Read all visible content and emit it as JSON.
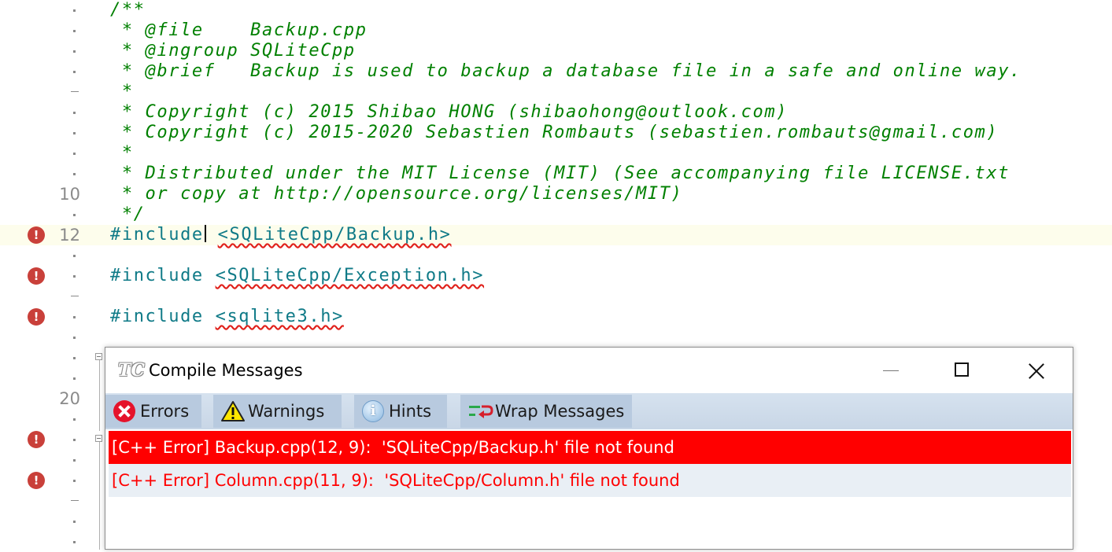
{
  "editor": {
    "lines": [
      {
        "gutter": "",
        "marker": "dot",
        "error": false,
        "segments": [
          {
            "cls": "comment",
            "text": "/**"
          }
        ]
      },
      {
        "gutter": "",
        "marker": "dot",
        "error": false,
        "segments": [
          {
            "cls": "comment",
            "text": " * @file    Backup.cpp"
          }
        ]
      },
      {
        "gutter": "",
        "marker": "dot",
        "error": false,
        "segments": [
          {
            "cls": "comment",
            "text": " * @ingroup SQLiteCpp"
          }
        ]
      },
      {
        "gutter": "",
        "marker": "dot",
        "error": false,
        "segments": [
          {
            "cls": "comment",
            "text": " * @brief   Backup is used to backup a database file in a safe and online way."
          }
        ]
      },
      {
        "gutter": "",
        "marker": "dash",
        "error": false,
        "segments": [
          {
            "cls": "comment",
            "text": " *"
          }
        ]
      },
      {
        "gutter": "",
        "marker": "dot",
        "error": false,
        "segments": [
          {
            "cls": "comment",
            "text": " * Copyright (c) 2015 Shibao HONG (shibaohong@outlook.com)"
          }
        ]
      },
      {
        "gutter": "",
        "marker": "dot",
        "error": false,
        "segments": [
          {
            "cls": "comment",
            "text": " * Copyright (c) 2015-2020 Sebastien Rombauts (sebastien.rombauts@gmail.com)"
          }
        ]
      },
      {
        "gutter": "",
        "marker": "dot",
        "error": false,
        "segments": [
          {
            "cls": "comment",
            "text": " *"
          }
        ]
      },
      {
        "gutter": "",
        "marker": "dot",
        "error": false,
        "segments": [
          {
            "cls": "comment",
            "text": " * Distributed under the MIT License (MIT) (See accompanying file LICENSE.txt"
          }
        ]
      },
      {
        "gutter": "10",
        "marker": "",
        "error": false,
        "segments": [
          {
            "cls": "comment",
            "text": " * or copy at http://opensource.org/licenses/MIT)"
          }
        ]
      },
      {
        "gutter": "",
        "marker": "dot",
        "error": false,
        "segments": [
          {
            "cls": "comment",
            "text": " */"
          }
        ]
      },
      {
        "gutter": "12",
        "marker": "",
        "error": true,
        "current": true,
        "caret": true,
        "segments": [
          {
            "cls": "directive",
            "text": "#include"
          },
          {
            "cls": "directive",
            "text": " "
          },
          {
            "cls": "incl",
            "text": "<SQLiteCpp/Backup.h>"
          }
        ]
      },
      {
        "gutter": "",
        "marker": "dot",
        "error": false,
        "segments": []
      },
      {
        "gutter": "",
        "marker": "dot",
        "error": true,
        "segments": [
          {
            "cls": "directive",
            "text": "#include "
          },
          {
            "cls": "incl",
            "text": "<SQLiteCpp/Exception.h>"
          }
        ]
      },
      {
        "gutter": "",
        "marker": "dash",
        "error": false,
        "segments": []
      },
      {
        "gutter": "",
        "marker": "dot",
        "error": true,
        "segments": [
          {
            "cls": "directive",
            "text": "#include "
          },
          {
            "cls": "incl",
            "text": "<sqlite3.h>"
          }
        ]
      },
      {
        "gutter": "",
        "marker": "dot",
        "error": false,
        "segments": []
      },
      {
        "gutter": "",
        "marker": "dot",
        "error": false,
        "segments": []
      },
      {
        "gutter": "",
        "marker": "dot",
        "error": false,
        "segments": []
      },
      {
        "gutter": "20",
        "marker": "",
        "error": false,
        "segments": []
      },
      {
        "gutter": "",
        "marker": "dot",
        "error": false,
        "segments": []
      },
      {
        "gutter": "",
        "marker": "dot",
        "error": true,
        "segments": []
      },
      {
        "gutter": "",
        "marker": "dot",
        "error": false,
        "segments": []
      },
      {
        "gutter": "",
        "marker": "dot",
        "error": true,
        "segments": []
      },
      {
        "gutter": "",
        "marker": "dash",
        "error": false,
        "segments": []
      },
      {
        "gutter": "",
        "marker": "dot",
        "error": false,
        "segments": []
      },
      {
        "gutter": "",
        "marker": "dot",
        "error": false,
        "segments": []
      }
    ]
  },
  "compile_messages": {
    "logo": "TC",
    "title": "Compile Messages",
    "toolbar": {
      "errors_label": "Errors",
      "warnings_label": "Warnings",
      "hints_label": "Hints",
      "wrap_label": "Wrap Messages"
    },
    "messages": [
      {
        "text": "[C++ Error] Backup.cpp(12, 9):  'SQLiteCpp/Backup.h' file not found",
        "selected": true
      },
      {
        "text": "[C++ Error] Column.cpp(11, 9):  'SQLiteCpp/Column.h' file not found",
        "selected": false
      }
    ]
  },
  "colors": {
    "comment": "#008000",
    "directive": "#0f7a87",
    "error_marker": "#c9403a",
    "selected_message_bg": "#ff0000",
    "message_text": "#ff0000",
    "toolbar_bg": "#c8d6e6"
  },
  "icons": {
    "gutter_error": "exclamation-circle-icon",
    "errors": "error-x-icon",
    "warnings": "warning-triangle-icon",
    "hints": "info-icon",
    "wrap": "wrap-arrow-icon",
    "fold": "fold-collapse-icon"
  }
}
